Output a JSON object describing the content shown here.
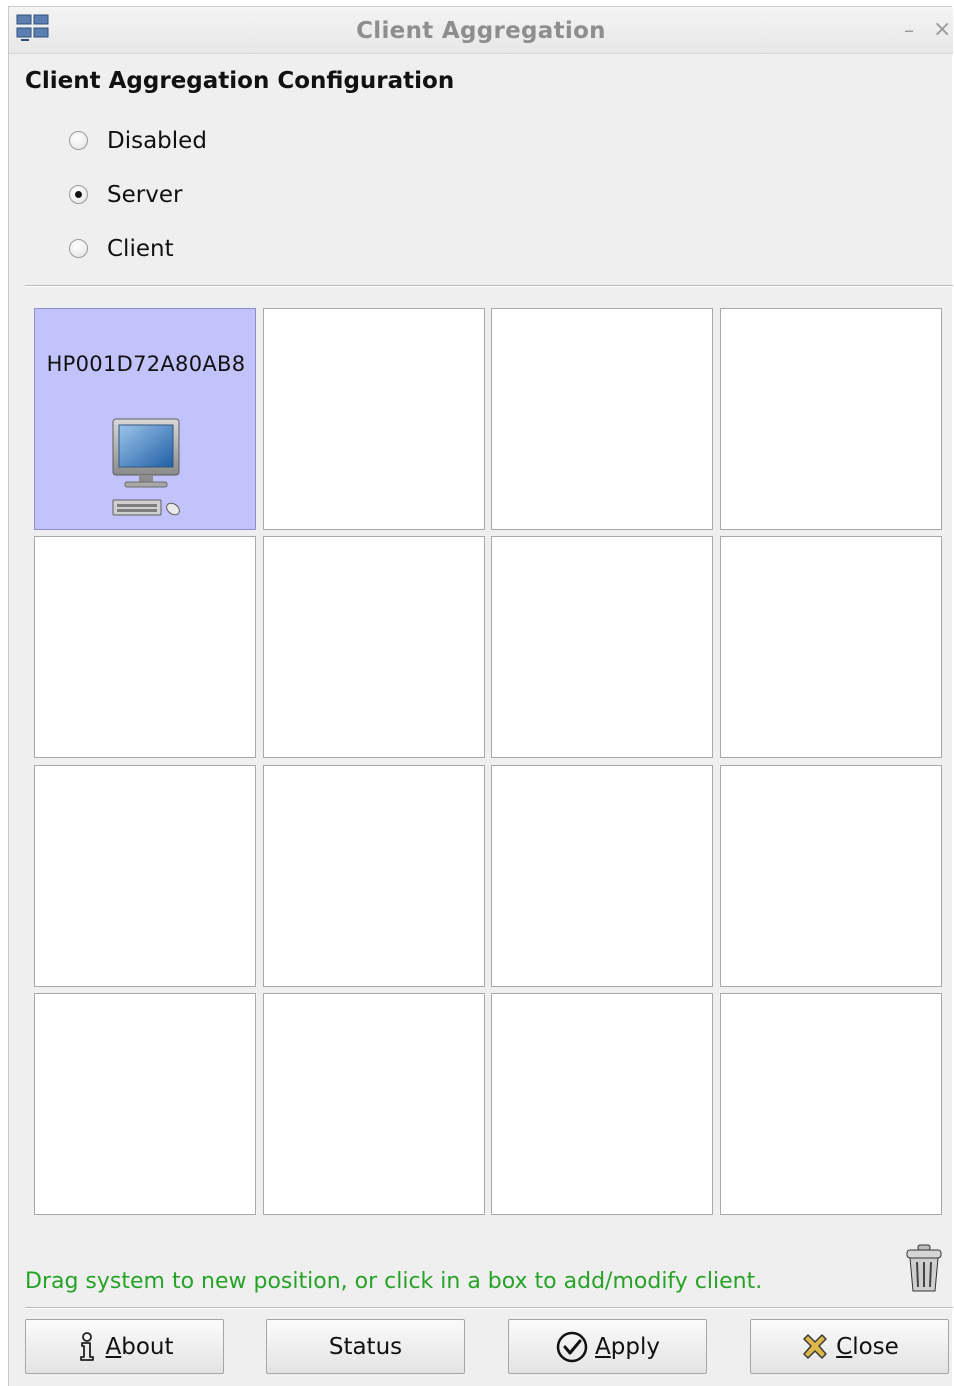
{
  "window": {
    "title": "Client Aggregation",
    "minimize_glyph": "–",
    "close_glyph": "×",
    "app_icon": "client-aggregation-app-icon"
  },
  "heading": "Client Aggregation Configuration",
  "mode": {
    "selected": "Server",
    "options": [
      {
        "label": "Disabled",
        "checked": false
      },
      {
        "label": "Server",
        "checked": true
      },
      {
        "label": "Client",
        "checked": false
      }
    ]
  },
  "grid": {
    "rows": 4,
    "cols": 4,
    "cells": [
      {
        "name": "HP001D72A80AB8",
        "icon": "computer-icon"
      },
      {
        "name": ""
      },
      {
        "name": ""
      },
      {
        "name": ""
      },
      {
        "name": ""
      },
      {
        "name": ""
      },
      {
        "name": ""
      },
      {
        "name": ""
      },
      {
        "name": ""
      },
      {
        "name": ""
      },
      {
        "name": ""
      },
      {
        "name": ""
      },
      {
        "name": ""
      },
      {
        "name": ""
      },
      {
        "name": ""
      },
      {
        "name": ""
      }
    ]
  },
  "hint": "Drag system to new position, or click in a box to add/modify client.",
  "trash_icon": "trash-can-icon",
  "buttons": {
    "about": {
      "mnemonic": "A",
      "rest": "bout",
      "icon": "info-person-icon"
    },
    "status": {
      "label": "Status"
    },
    "apply": {
      "mnemonic": "A",
      "rest": "pply",
      "icon": "checkmark-circle-icon"
    },
    "close": {
      "mnemonic": "C",
      "rest": "lose",
      "icon": "close-x-icon"
    }
  },
  "colors": {
    "occupied_cell": "#c3c3fb",
    "hint_text": "#26a326",
    "window_bg": "#efefef"
  }
}
